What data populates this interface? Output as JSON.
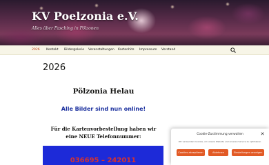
{
  "header": {
    "site_title": "KV Poelzonia e.V.",
    "tagline": "Alles über Fasching in Pölzonen"
  },
  "nav": {
    "items": [
      {
        "label": "2026",
        "active": true
      },
      {
        "label": "Kontakt"
      },
      {
        "label": "Bildergalerie"
      },
      {
        "label": "Veranstaltungen"
      },
      {
        "label": "Kartenhits"
      },
      {
        "label": "Impressum"
      },
      {
        "label": "Vorstand"
      }
    ],
    "search_icon": "search-icon"
  },
  "main": {
    "page_title": "2026",
    "headline": "Pölzonia Helau",
    "subline": "Alle Bilder sind nun online!",
    "notice_line1": "Für die Kartenvorbestellung haben wir",
    "notice_line2": "eine NEUE Telefonnummer:",
    "phone": "036695 – 242011"
  },
  "cookie": {
    "title": "Cookie-Zustimmung verwalten",
    "text": "Wir verwenden Cookies, um unsere Website und unseren Service zu optimieren.",
    "accept_label": "Cookies akzeptieren",
    "deny_label": "Ablehnen",
    "prefs_label": "Einstellungen anzeigen",
    "close_icon": "close-icon"
  },
  "colors": {
    "accent": "#bc360a",
    "nav_bg": "#f7f5e7",
    "banner_blue": "#1d2ad8",
    "phone_red": "#d8322c",
    "subline_blue": "#1a2f9e",
    "cookie_button": "#e25a25"
  }
}
